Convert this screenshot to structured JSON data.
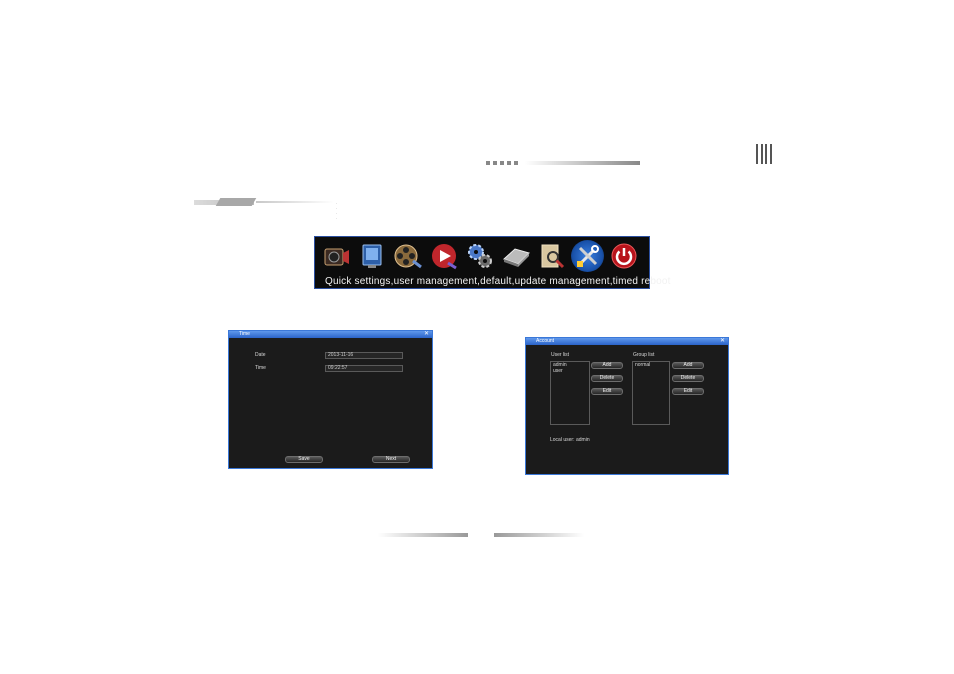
{
  "menu": {
    "items": [
      {
        "name": "record-icon"
      },
      {
        "name": "display-icon"
      },
      {
        "name": "film-reel-icon"
      },
      {
        "name": "playback-icon"
      },
      {
        "name": "gears-icon"
      },
      {
        "name": "hard-disk-icon"
      },
      {
        "name": "search-icon"
      },
      {
        "name": "tools-icon"
      },
      {
        "name": "power-icon"
      }
    ],
    "selected_index": 7,
    "caption": "Quick  settings,user  management,default,update  management,timed  reboot"
  },
  "time_window": {
    "title": "Time",
    "date_label": "Date",
    "date_value": "2013-11-16",
    "time_label": "Time",
    "time_value": "09:22:57",
    "save_label": "Save",
    "next_label": "Next"
  },
  "account_window": {
    "title": "Account",
    "user_list_label": "User list",
    "users": [
      "admin",
      "user"
    ],
    "group_list_label": "Group list",
    "groups": [
      "normal"
    ],
    "add_label": "Add",
    "delete_label": "Delete",
    "edit_label": "Edit",
    "local_user_label": "Local user:",
    "local_user_value": "admin"
  },
  "colors": {
    "accent_blue": "#3b78d8",
    "window_bg": "#1b1b1b",
    "menubar_bg": "#0c0c0c"
  }
}
